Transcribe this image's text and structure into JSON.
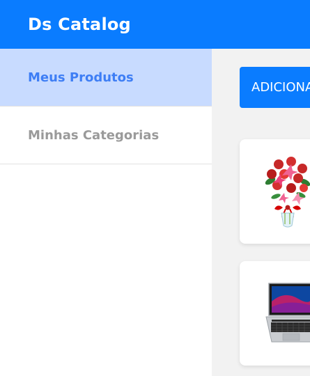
{
  "header": {
    "brand": "Ds Catalog"
  },
  "sidebar": {
    "items": [
      {
        "label": "Meus Produtos",
        "active": true
      },
      {
        "label": "Minhas Categorias",
        "active": false
      }
    ]
  },
  "main": {
    "add_button_label": "ADICIONAR",
    "products": [
      {
        "image": "flower-bouquet-image"
      },
      {
        "image": "laptop-image"
      }
    ]
  },
  "colors": {
    "primary": "#0a7cff",
    "active_bg": "#c8dbff",
    "active_text": "#3e7ef5",
    "muted_text": "#9a9a9a",
    "content_bg": "#f2f2f2"
  }
}
